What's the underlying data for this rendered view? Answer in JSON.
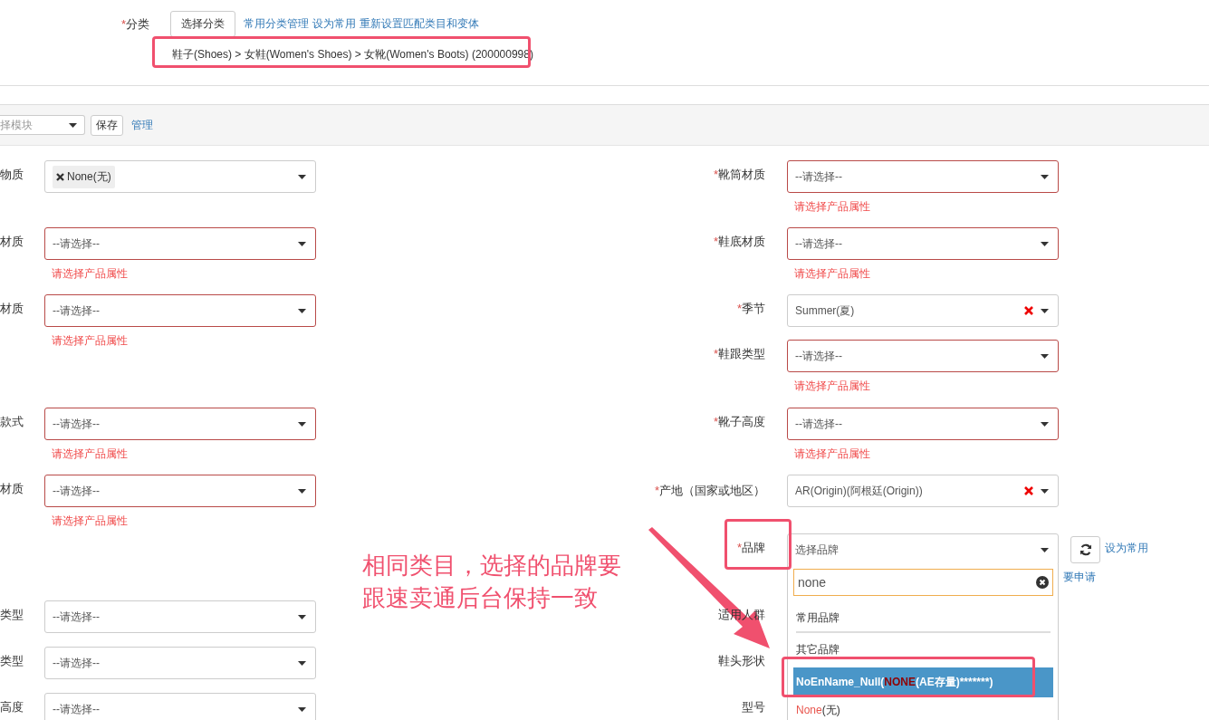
{
  "category": {
    "label": "分类",
    "required": true,
    "button": "选择分类",
    "links": [
      {
        "text": "常用分类管理"
      },
      {
        "text": "设为常用"
      },
      {
        "text": "重新设置匹配类目和变体"
      }
    ],
    "path": "鞋子(Shoes) > 女鞋(Women's Shoes) > 女靴(Women's Boots) (200000998)"
  },
  "toolbar": {
    "module_select": "择模块",
    "save": "保存",
    "manage": "管理"
  },
  "rows": [
    {
      "left": {
        "label": "物质",
        "kind": "tags",
        "tags": [
          {
            "text": "None(无)"
          }
        ]
      },
      "right": {
        "label": "靴筒材质",
        "required": true,
        "kind": "select",
        "placeholder": "--请选择--",
        "error": "请选择产品属性"
      }
    },
    {
      "left": {
        "label": "材质",
        "kind": "select",
        "placeholder": "--请选择--",
        "error": "请选择产品属性"
      },
      "right": {
        "label": "鞋底材质",
        "required": true,
        "kind": "select",
        "placeholder": "--请选择--",
        "error": "请选择产品属性"
      }
    },
    {
      "left": {
        "label": "材质",
        "kind": "select",
        "placeholder": "--请选择--",
        "error": "请选择产品属性"
      },
      "right": {
        "label": "季节",
        "required": true,
        "kind": "select",
        "value": "Summer(夏)",
        "clearable": true
      }
    },
    {
      "right": {
        "label": "鞋跟类型",
        "required": true,
        "kind": "select",
        "placeholder": "--请选择--",
        "error": "请选择产品属性"
      }
    },
    {
      "left": {
        "label": "款式",
        "kind": "select",
        "placeholder": "--请选择--",
        "error": "请选择产品属性"
      },
      "right": {
        "label": "靴子高度",
        "required": true,
        "kind": "select",
        "placeholder": "--请选择--",
        "error": "请选择产品属性"
      }
    },
    {
      "left": {
        "label": "材质",
        "kind": "select",
        "placeholder": "--请选择--",
        "error": "请选择产品属性"
      },
      "right": {
        "label": "产地（国家或地区）",
        "required": true,
        "kind": "select",
        "value": "AR(Origin)(阿根廷(Origin))",
        "clearable": true
      }
    },
    {
      "right": {
        "label": "品牌",
        "required": true,
        "kind": "brand",
        "placeholder": "选择品牌",
        "set_common": "设为常用",
        "apply": "要申请",
        "dropdown": {
          "search": "none",
          "groups": [
            {
              "label": "常用品牌"
            },
            {
              "label": "其它品牌",
              "options": [
                {
                  "parts": [
                    {
                      "text": "NoEnName_Null("
                    },
                    {
                      "text": "NONE",
                      "match": true
                    },
                    {
                      "text": "(AE存量)*******)"
                    }
                  ],
                  "selected": true
                },
                {
                  "parts": [
                    {
                      "text": "None",
                      "match": true
                    },
                    {
                      "text": "(无)"
                    }
                  ],
                  "selected": false
                }
              ]
            }
          ]
        }
      }
    },
    {
      "left": {
        "label": "类型",
        "kind": "select",
        "placeholder": "--请选择--"
      },
      "right": {
        "label": "适用人群"
      }
    },
    {
      "left": {
        "label": "类型",
        "kind": "select",
        "placeholder": "--请选择--"
      },
      "right": {
        "label": "鞋头形状"
      }
    },
    {
      "left": {
        "label": "高度",
        "kind": "select",
        "placeholder": "--请选择--"
      },
      "right": {
        "label": "型号"
      }
    }
  ],
  "required_mark": "*",
  "note": [
    "相同类目，选择的品牌要",
    "跟速卖通后台保持一致"
  ]
}
